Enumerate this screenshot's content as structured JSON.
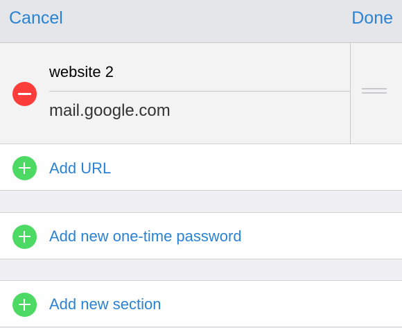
{
  "nav": {
    "cancel_label": "Cancel",
    "done_label": "Done"
  },
  "edit_row": {
    "field_label": "website 2",
    "field_value": "mail.google.com"
  },
  "actions": {
    "add_url": "Add URL",
    "add_otp": "Add new one-time password",
    "add_section": "Add new section"
  },
  "colors": {
    "accent": "#2a82d4",
    "delete": "#fc3d39",
    "add": "#4cd964"
  }
}
